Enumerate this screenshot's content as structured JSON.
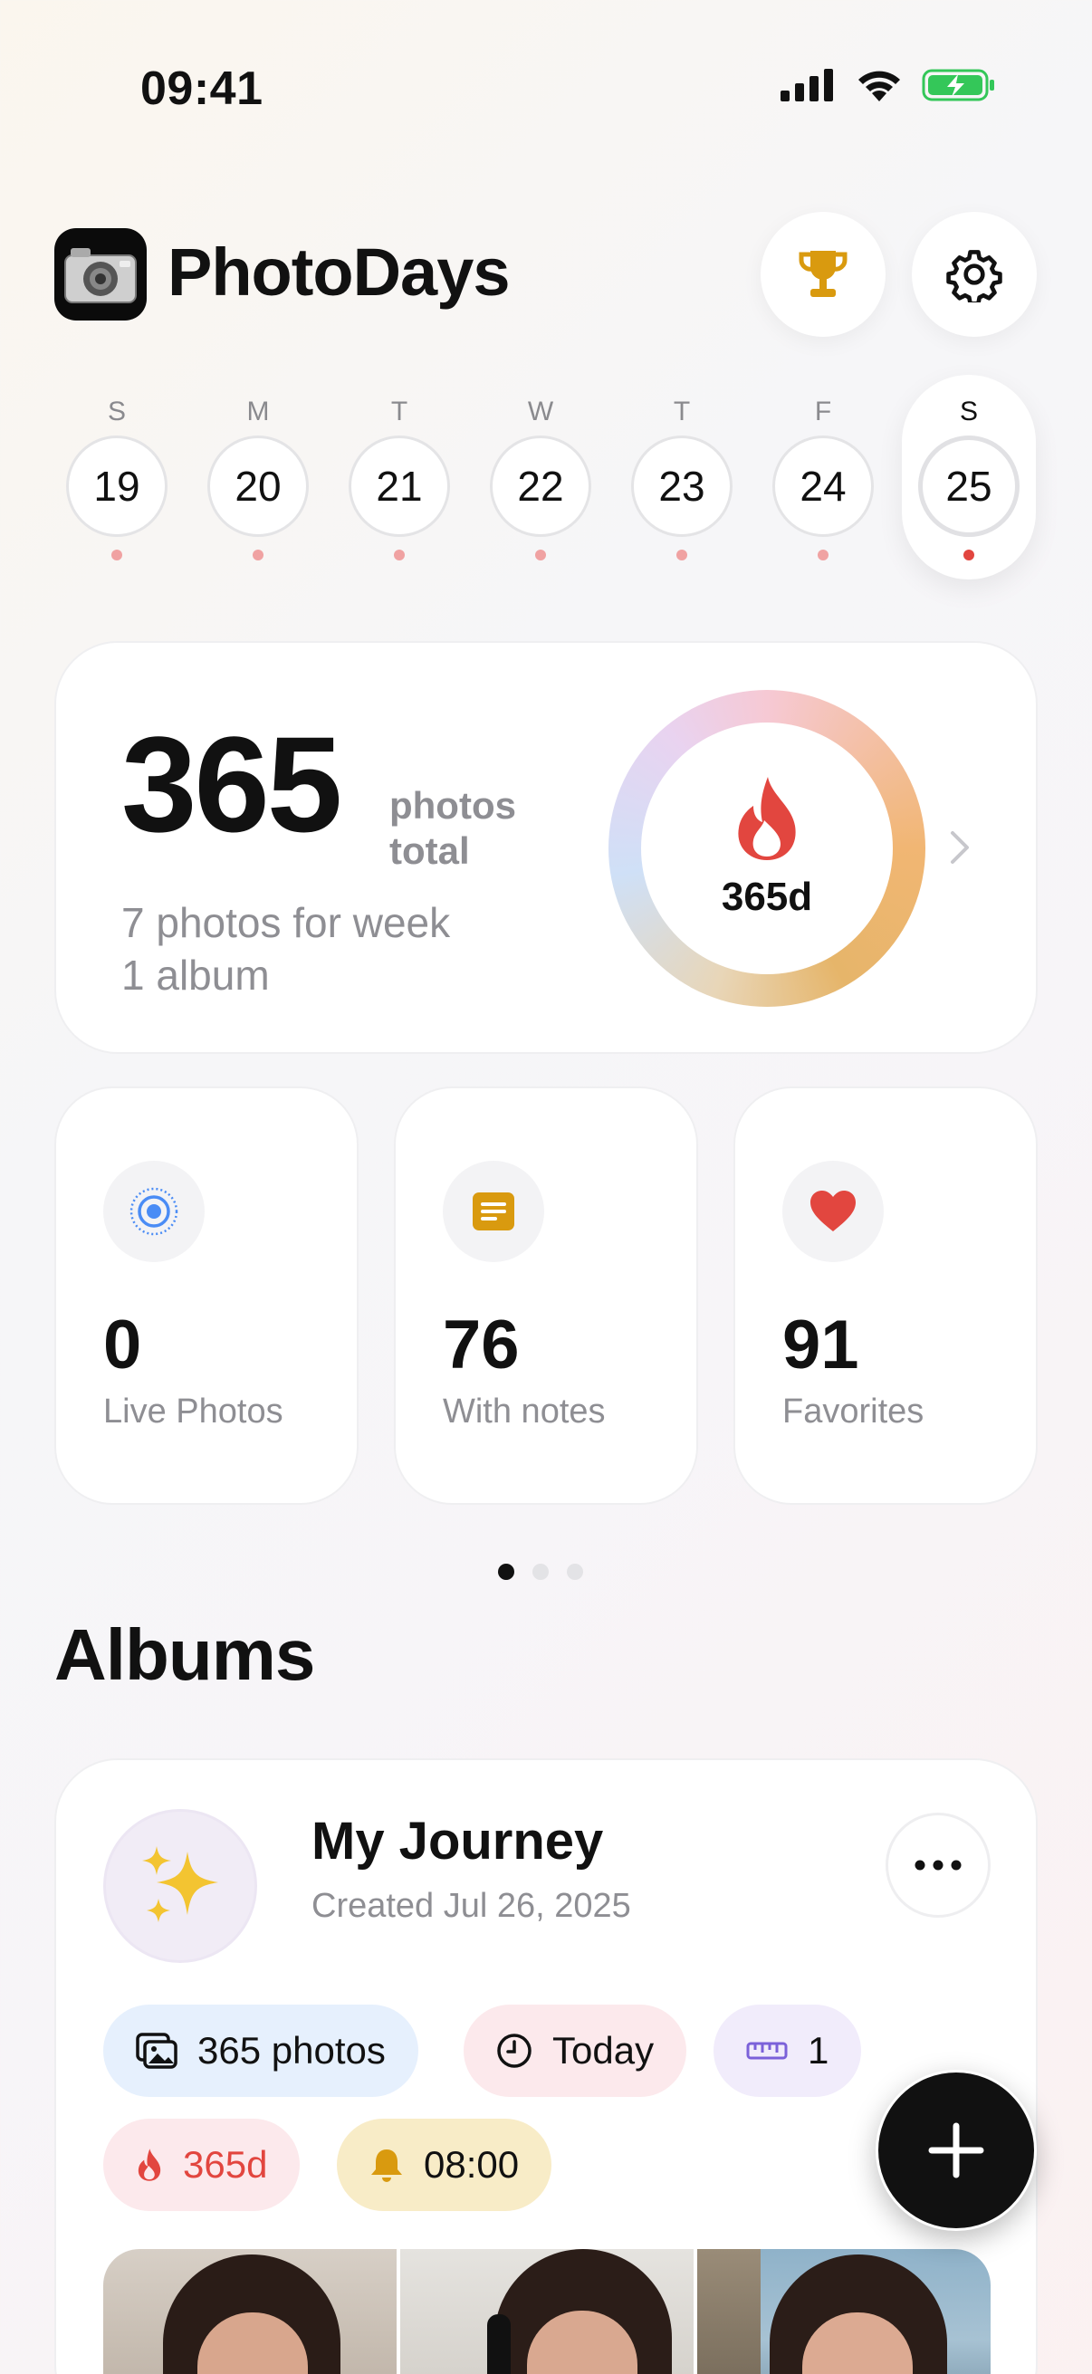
{
  "status_bar": {
    "time": "09:41"
  },
  "header": {
    "title": "PhotoDays",
    "trophy_icon": "trophy-icon",
    "settings_icon": "gear-icon"
  },
  "week": {
    "days": [
      {
        "letter": "S",
        "number": "19"
      },
      {
        "letter": "M",
        "number": "20"
      },
      {
        "letter": "T",
        "number": "21"
      },
      {
        "letter": "W",
        "number": "22"
      },
      {
        "letter": "T",
        "number": "23"
      },
      {
        "letter": "F",
        "number": "24"
      },
      {
        "letter": "S",
        "number": "25"
      }
    ],
    "selected_index": 6
  },
  "summary": {
    "total": "365",
    "total_unit_line1": "photos",
    "total_unit_line2": "total",
    "week_line": "7 photos for week",
    "album_line": "1 album",
    "streak": "365d"
  },
  "stats": [
    {
      "icon": "live-photo-icon",
      "value": "0",
      "label": "Live Photos"
    },
    {
      "icon": "note-icon",
      "value": "76",
      "label": "With notes"
    },
    {
      "icon": "heart-icon",
      "value": "91",
      "label": "Favorites"
    }
  ],
  "pager": {
    "count": 3,
    "active": 0
  },
  "albums_title": "Albums",
  "album": {
    "name": "My Journey",
    "created": "Created Jul 26, 2025",
    "pills": {
      "photos": "365 photos",
      "when": "Today",
      "count": "1",
      "streak": "365d",
      "reminder": "08:00"
    }
  },
  "colors": {
    "accent_red": "#e2463f",
    "gold": "#d99a0f",
    "blue": "#4a8cf5",
    "purple": "#7b61d9"
  }
}
